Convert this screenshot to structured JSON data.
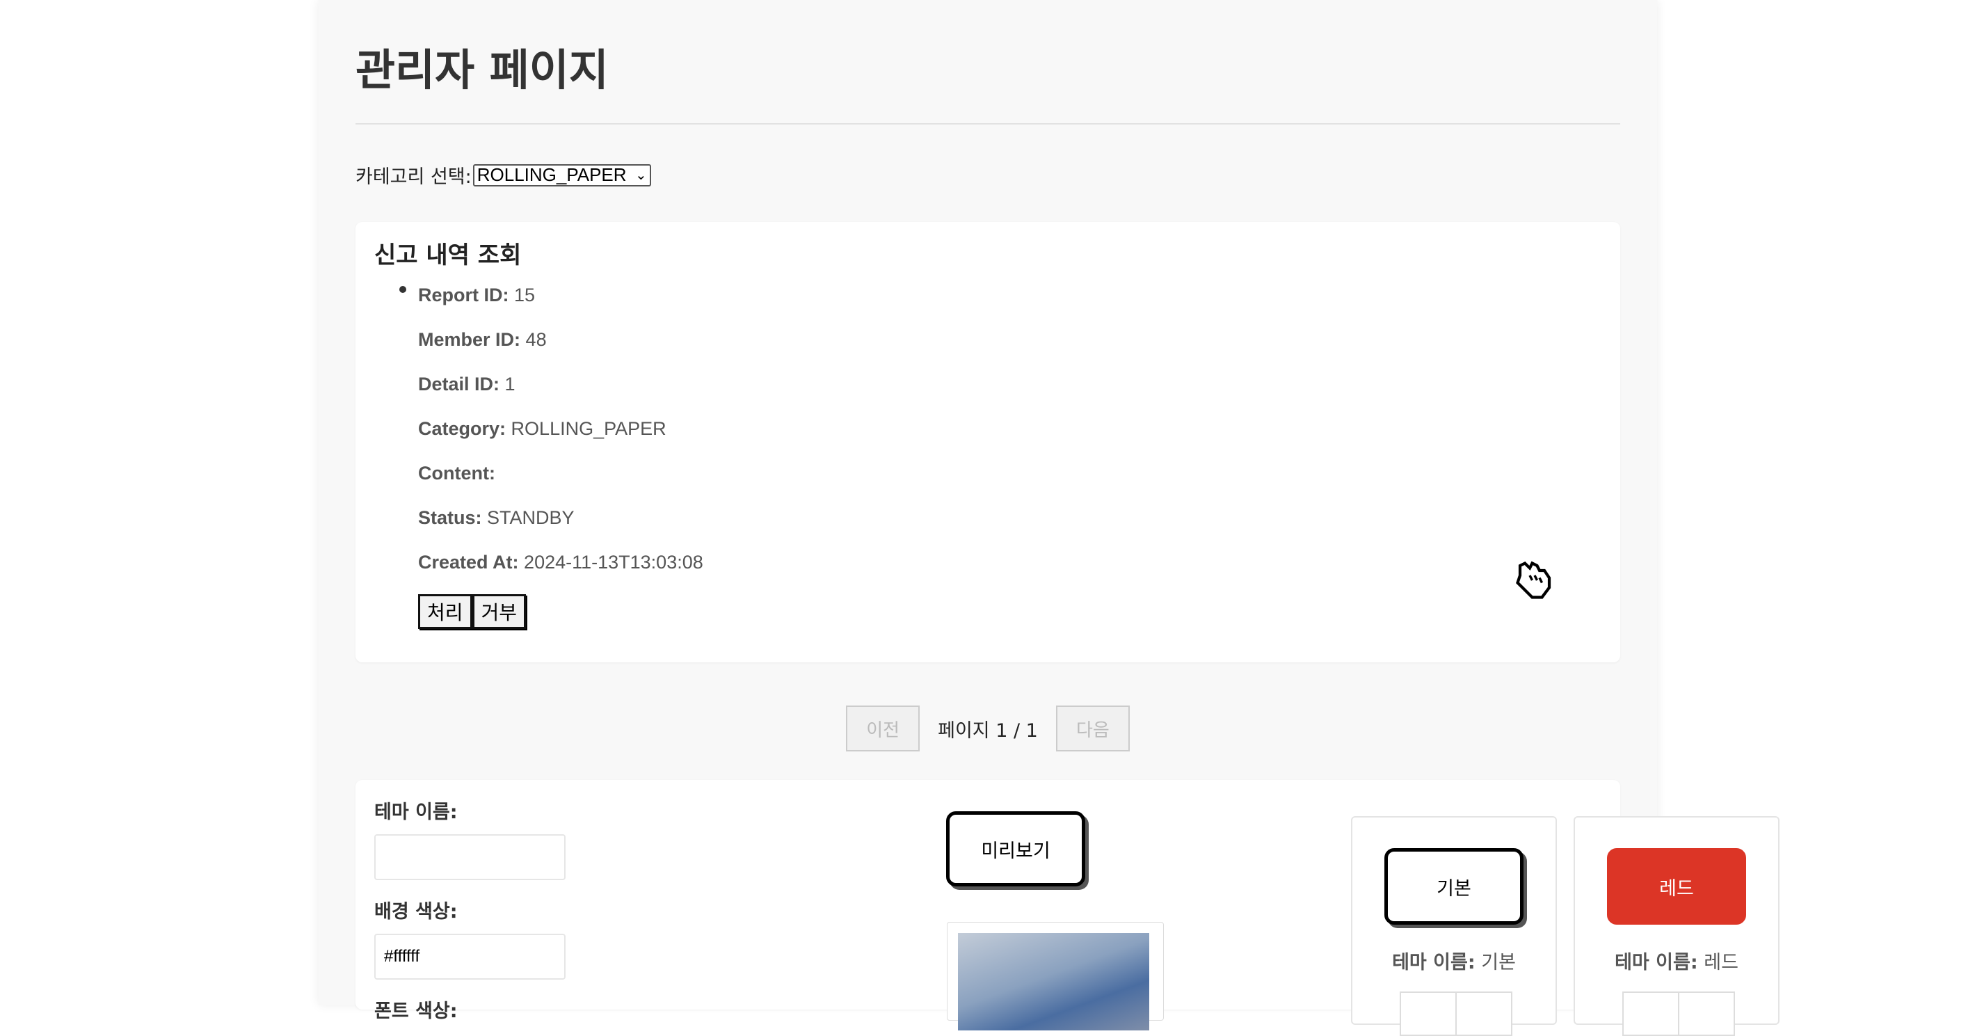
{
  "page": {
    "title": "관리자 페이지"
  },
  "category": {
    "label": "카테고리 선택:",
    "selected": "ROLLING_PAPER"
  },
  "report": {
    "section_title": "신고 내역 조회",
    "fields": [
      {
        "label": "Report ID:",
        "value": "15"
      },
      {
        "label": "Member ID:",
        "value": "48"
      },
      {
        "label": "Detail ID:",
        "value": "1"
      },
      {
        "label": "Category:",
        "value": "ROLLING_PAPER"
      },
      {
        "label": "Content:",
        "value": ""
      },
      {
        "label": "Status:",
        "value": "STANDBY"
      },
      {
        "label": "Created At:",
        "value": "2024-11-13T13:03:08"
      }
    ],
    "process_label": "처리",
    "reject_label": "거부"
  },
  "pagination": {
    "prev_label": "이전",
    "page_text": "페이지 1 / 1",
    "next_label": "다음"
  },
  "theme_form": {
    "name_label": "테마 이름:",
    "name_value": "",
    "bg_label": "배경 색상:",
    "bg_value": "#ffffff",
    "font_label": "폰트 색상:",
    "preview_label": "미리보기"
  },
  "themes": [
    {
      "button_label": "기본",
      "name_label": "테마 이름:",
      "name_value": "기본",
      "color": "#ffffff"
    },
    {
      "button_label": "레드",
      "name_label": "테마 이름:",
      "name_value": "레드",
      "color": "#dc3526"
    }
  ],
  "icons": {
    "cursor": "hand-cursor-icon"
  }
}
